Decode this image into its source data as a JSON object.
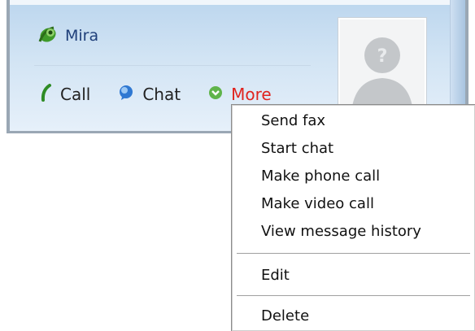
{
  "contact": {
    "name": "Mira",
    "status_icon": "green-contact-icon"
  },
  "actions": {
    "call_label": "Call",
    "chat_label": "Chat",
    "more_label": "More",
    "more_color": "#e0241f"
  },
  "avatar": {
    "icon": "placeholder-silhouette",
    "glyph": "?"
  },
  "menu": {
    "items": [
      "Send fax",
      "Start chat",
      "Make phone call",
      "Make video call",
      "View message history"
    ],
    "edit_label": "Edit",
    "delete_label": "Delete"
  }
}
